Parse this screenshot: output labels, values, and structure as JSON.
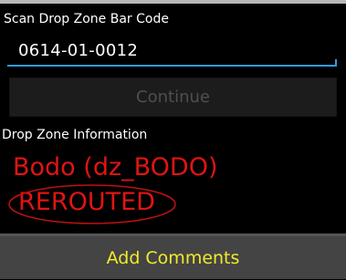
{
  "scan": {
    "label": "Scan Drop Zone Bar Code",
    "barcode_value": "0614-01-0012"
  },
  "actions": {
    "continue_label": "Continue",
    "add_comments_label": "Add Comments"
  },
  "drop_zone": {
    "section_label": "Drop Zone Information",
    "name": "Bodo (dz_BODO)",
    "status": "REROUTED"
  },
  "colors": {
    "background": "#000000",
    "input_accent": "#2d9de3",
    "alert_text": "#e01414",
    "comments_text": "#f2ea2a"
  }
}
